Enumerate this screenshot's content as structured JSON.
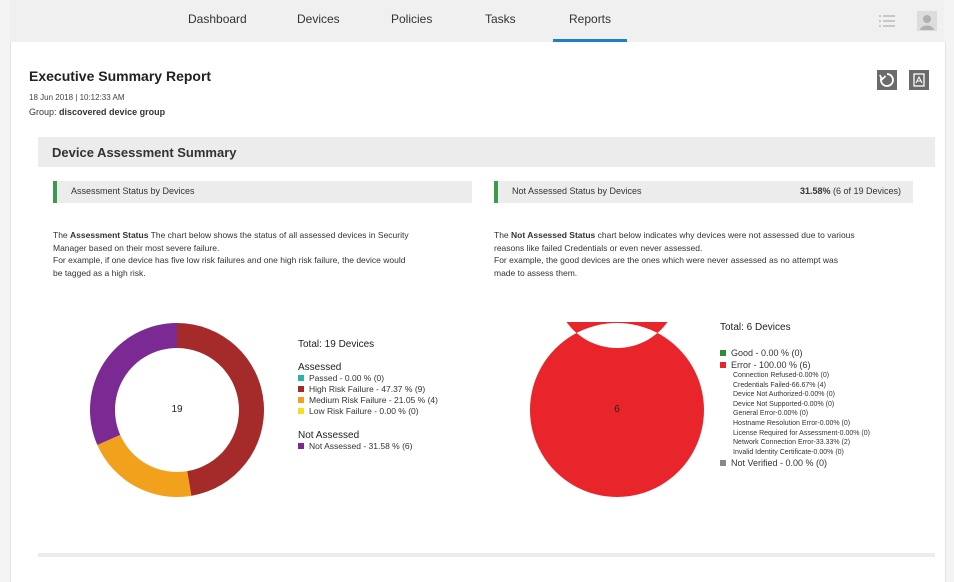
{
  "nav": {
    "tabs": [
      "Dashboard",
      "Devices",
      "Policies",
      "Tasks",
      "Reports"
    ],
    "active_tab": "Reports",
    "icons": [
      "list-icon",
      "user-avatar-icon"
    ],
    "accent_color": "#1f7fc4"
  },
  "report": {
    "title": "Executive Summary Report",
    "date": "18 Jun 2018 | 10:12:33 AM",
    "group_label": "Group:",
    "group_value": "discovered device group",
    "actions": [
      "refresh-icon",
      "pdf-export-icon"
    ]
  },
  "summary": {
    "title": "Device Assessment Summary",
    "left": {
      "bar_label": "Assessment Status by Devices",
      "desc_bold": "Assessment Status",
      "desc_line1": " The chart below shows the status of all assessed devices in Security",
      "desc_line2": "Manager based on their most severe failure.",
      "desc_line3": "For example, if one device has five low risk failures and one high risk failure, the device would",
      "desc_line4": "be tagged as a high risk.",
      "center_value": "19",
      "total": "Total: 19 Devices",
      "assessed_label": "Assessed",
      "assessed_items": [
        {
          "label": "Passed - 0.00 % (0)",
          "color": "#26b5a6"
        },
        {
          "label": "High Risk Failure - 47.37 % (9)",
          "color": "#a52a2a"
        },
        {
          "label": "Medium Risk Failure - 21.05 % (4)",
          "color": "#f2a11c"
        },
        {
          "label": "Low Risk Failure - 0.00 % (0)",
          "color": "#f5e01e"
        }
      ],
      "not_assessed_label": "Not Assessed",
      "not_assessed_items": [
        {
          "label": "Not Assessed - 31.58 % (6)",
          "color": "#7b2a93"
        }
      ]
    },
    "right": {
      "bar_label": "Not Assessed Status by Devices",
      "bar_value_bold": "31.58%",
      "bar_value_rest": " (6 of 19 Devices)",
      "desc_pre": "The ",
      "desc_bold": "Not Assessed Status",
      "desc_line1": " chart below indicates why devices were not assessed due to various",
      "desc_line2": "reasons like failed Credentials or even never assessed.",
      "desc_line3": "For example, the good devices are the ones which were never assessed as no attempt was",
      "desc_line4": "made to assess them.",
      "center_value": "6",
      "total": "Total: 6 Devices",
      "good": {
        "label": "Good - 0.00 % (0)",
        "color": "#2e8b3a"
      },
      "error": {
        "label": "Error - 100.00 % (6)",
        "color": "#e8252a"
      },
      "error_details": [
        "Connection Refused-0.00% (0)",
        "Credentials Failed-66.67% (4)",
        "Device Not Authorized-0.00% (0)",
        "Device Not Supported-0.00% (0)",
        "General Error-0.00% (0)",
        "Hostname Resolution Error-0.00% (0)",
        "License Required for Assessment-0.00% (0)",
        "Network Connection Error-33.33% (2)",
        "Invalid Identity Certificate-0.00% (0)"
      ],
      "not_verified": {
        "label": "Not Verified - 0.00 % (0)",
        "color": "#888888"
      }
    }
  },
  "chart_data": [
    {
      "type": "pie",
      "categories": [
        "Passed",
        "High Risk Failure",
        "Medium Risk Failure",
        "Low Risk Failure",
        "Not Assessed"
      ],
      "values": [
        0,
        9,
        4,
        0,
        6
      ],
      "colors": [
        "#26b5a6",
        "#a52a2a",
        "#f2a11c",
        "#f5e01e",
        "#7b2a93"
      ],
      "title": "Total: 19 Devices"
    },
    {
      "type": "pie",
      "categories": [
        "Good",
        "Error",
        "Not Verified"
      ],
      "values": [
        0,
        6,
        0
      ],
      "colors": [
        "#2e8b3a",
        "#e8252a",
        "#888888"
      ],
      "title": "Total: 6 Devices"
    }
  ]
}
